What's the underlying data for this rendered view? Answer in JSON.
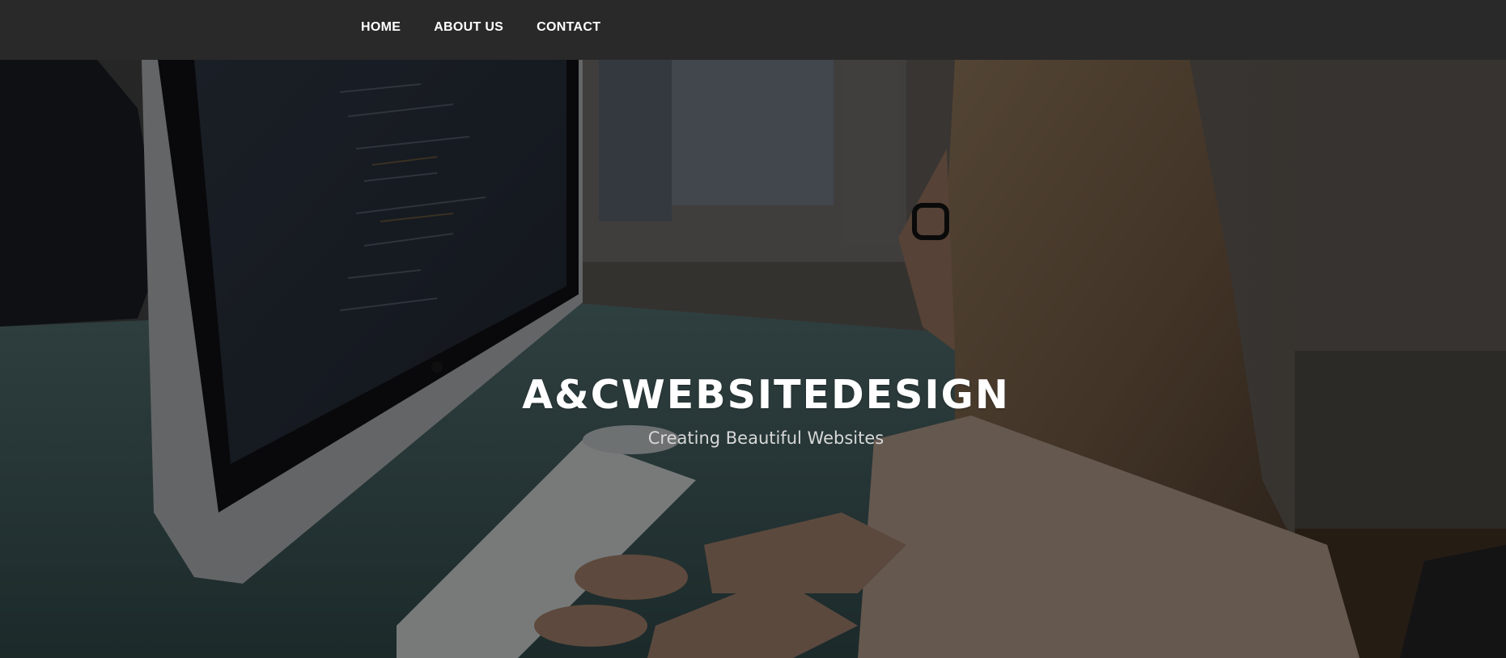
{
  "nav": {
    "items": [
      {
        "label": "HOME"
      },
      {
        "label": "ABOUT US"
      },
      {
        "label": "CONTACT"
      }
    ]
  },
  "hero": {
    "title": "A&CWEBSITEDESIGN",
    "subtitle": "Creating Beautiful Websites",
    "image_subject": "woman-coding-at-desktop-computer",
    "overlay_color": "#000000"
  },
  "colors": {
    "nav_background": "#292929",
    "nav_text": "#ffffff",
    "title_text": "#ffffff",
    "subtitle_text": "#d8d8d8"
  }
}
